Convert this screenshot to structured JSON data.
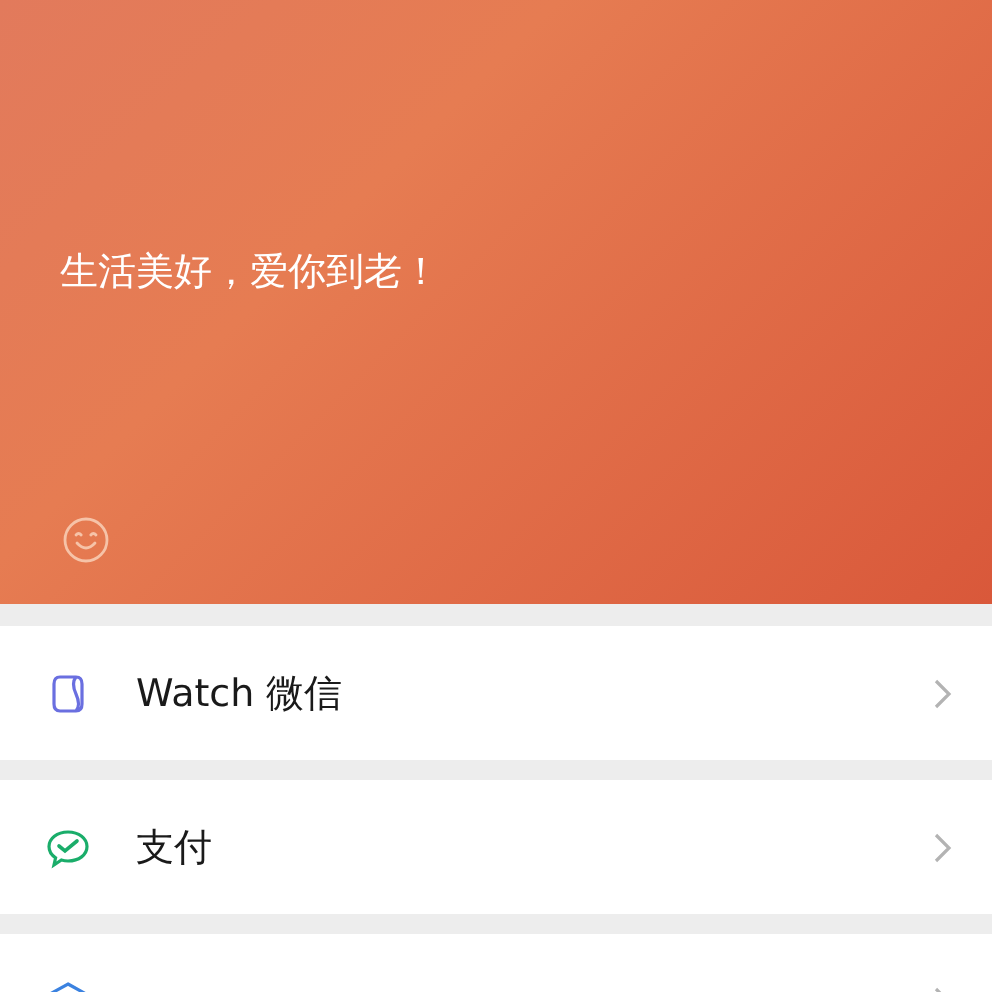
{
  "header": {
    "motto": "生活美好，爱你到老！"
  },
  "menu": [
    {
      "label": "Watch 微信"
    },
    {
      "label": "支付"
    }
  ]
}
